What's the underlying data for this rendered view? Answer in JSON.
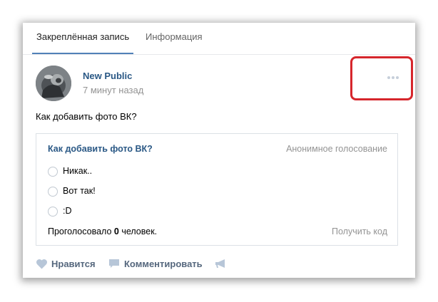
{
  "tabs": [
    {
      "label": "Закреплённая запись",
      "active": true
    },
    {
      "label": "Информация",
      "active": false
    }
  ],
  "post": {
    "author": "New Public",
    "time": "7 минут назад",
    "text": "Как добавить фото ВК?",
    "menu_icon": "more-dots-icon"
  },
  "poll": {
    "title": "Как добавить фото ВК?",
    "type": "Анонимное голосование",
    "options": [
      "Никак..",
      "Вот так!",
      ":D"
    ],
    "votes_prefix": "Проголосовало ",
    "votes_count": "0",
    "votes_suffix": " человек.",
    "get_code": "Получить код"
  },
  "actions": {
    "like_label": "Нравится",
    "comment_label": "Комментировать",
    "like_icon": "heart-icon",
    "comment_icon": "comment-icon",
    "share_icon": "megaphone-icon"
  },
  "colors": {
    "link": "#2a5885",
    "accent": "#5181b8",
    "highlight": "#d6262c"
  }
}
